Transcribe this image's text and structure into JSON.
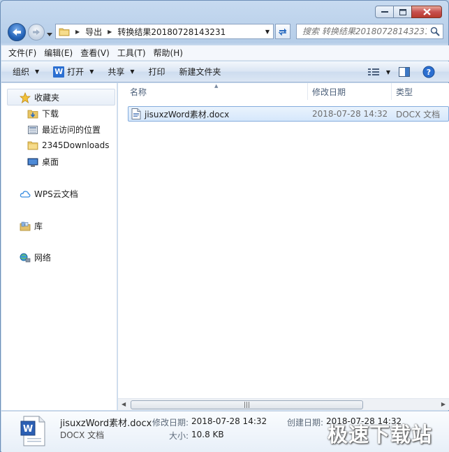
{
  "window": {
    "caption_buttons": [
      "minimize",
      "maximize",
      "close"
    ]
  },
  "address": {
    "segments": [
      "导出",
      "转换结果20180728143231"
    ]
  },
  "search": {
    "placeholder": "搜索 转换结果20180728143231"
  },
  "menu": [
    "文件(F)",
    "编辑(E)",
    "查看(V)",
    "工具(T)",
    "帮助(H)"
  ],
  "toolbar": {
    "organize": "组织",
    "open": "打开",
    "share": "共享",
    "print": "打印",
    "new_folder": "新建文件夹"
  },
  "nav": {
    "favorites": "收藏夹",
    "downloads": "下载",
    "recent": "最近访问的位置",
    "downloads2345": "2345Downloads",
    "desktop": "桌面",
    "wps": "WPS云文档",
    "libraries": "库",
    "network": "网络"
  },
  "columns": {
    "name": "名称",
    "modified": "修改日期",
    "type": "类型"
  },
  "files": [
    {
      "name": "jisuxzWord素材.docx",
      "modified": "2018-07-28 14:32",
      "type": "DOCX 文档"
    }
  ],
  "details": {
    "file_name": "jisuxzWord素材.docx",
    "file_type": "DOCX 文档",
    "modified_label": "修改日期:",
    "modified_value": "2018-07-28 14:32",
    "created_label": "创建日期:",
    "created_value": "2018-07-28 14:32",
    "size_label": "大小:",
    "size_value": "10.8 KB"
  },
  "watermark": "极速下载站",
  "colors": {
    "frame": "#b9d1ea",
    "selection": "#d5e7fb",
    "close_button": "#c75050"
  }
}
